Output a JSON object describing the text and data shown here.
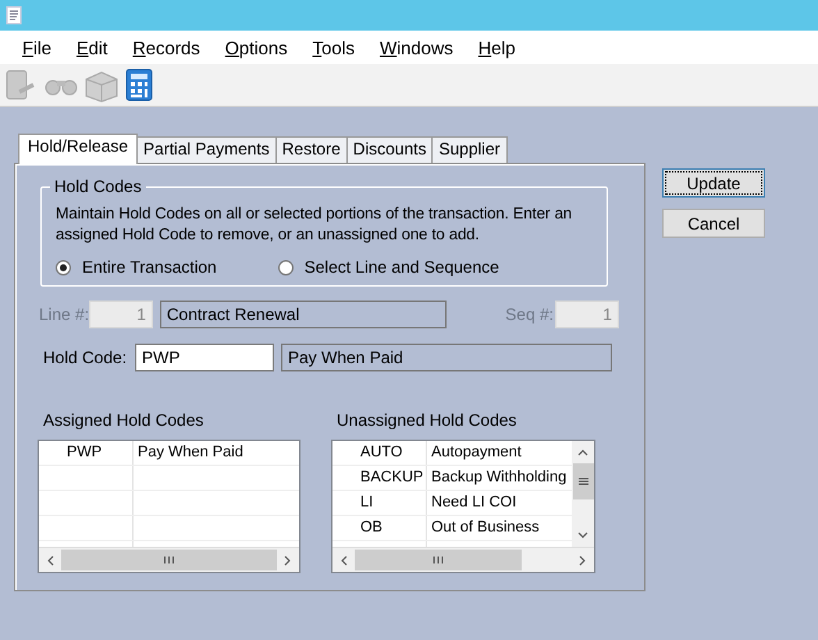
{
  "menu": [
    "File",
    "Edit",
    "Records",
    "Options",
    "Tools",
    "Windows",
    "Help"
  ],
  "tabs": [
    {
      "label": "Hold/Release",
      "selected": true
    },
    {
      "label": "Partial Payments",
      "selected": false
    },
    {
      "label": "Restore",
      "selected": false
    },
    {
      "label": "Discounts",
      "selected": false
    },
    {
      "label": "Supplier",
      "selected": false
    }
  ],
  "buttons": [
    {
      "label": "Update",
      "focused": true
    },
    {
      "label": "Cancel",
      "focused": false
    }
  ],
  "hold_codes": {
    "title": "Hold Codes",
    "description": "Maintain Hold Codes on all or selected portions of the transaction.  Enter an assigned Hold Code to remove, or an unassigned one to add.",
    "options": [
      {
        "label": "Entire Transaction",
        "selected": true
      },
      {
        "label": "Select Line and Sequence",
        "selected": false
      }
    ]
  },
  "line_selection": {
    "disabled": true,
    "line_label": "Line #:",
    "line_value": "1",
    "line_description": "Contract Renewal",
    "seq_label": "Seq #:",
    "seq_value": "1"
  },
  "hold_code": {
    "label": "Hold Code:",
    "value": "PWP",
    "description": "Pay When Paid"
  },
  "assigned": {
    "title": "Assigned Hold Codes",
    "rows": [
      {
        "code": "PWP",
        "description": "Pay When Paid"
      }
    ]
  },
  "unassigned": {
    "title": "Unassigned Hold Codes",
    "rows": [
      {
        "code": "AUTO",
        "description": "Autopayment"
      },
      {
        "code": "BACKUP",
        "description": "Backup Withholding"
      },
      {
        "code": "LI",
        "description": "Need LI COI"
      },
      {
        "code": "OB",
        "description": "Out of Business"
      }
    ]
  }
}
